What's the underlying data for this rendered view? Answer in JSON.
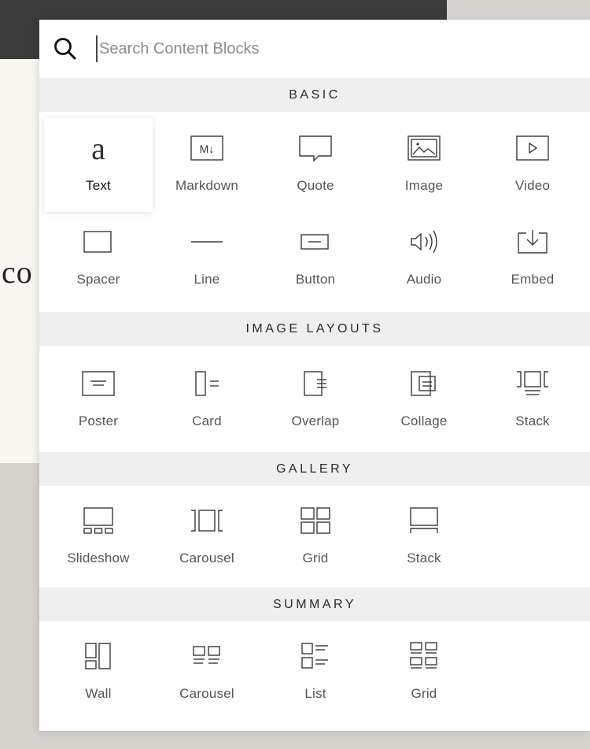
{
  "background": {
    "partial_text": "co"
  },
  "search": {
    "placeholder": "Search Content Blocks",
    "value": ""
  },
  "sections": {
    "basic": {
      "title": "BASIC",
      "items": [
        "Text",
        "Markdown",
        "Quote",
        "Image",
        "Video",
        "Spacer",
        "Line",
        "Button",
        "Audio",
        "Embed"
      ]
    },
    "image_layouts": {
      "title": "IMAGE LAYOUTS",
      "items": [
        "Poster",
        "Card",
        "Overlap",
        "Collage",
        "Stack"
      ]
    },
    "gallery": {
      "title": "GALLERY",
      "items": [
        "Slideshow",
        "Carousel",
        "Grid",
        "Stack"
      ]
    },
    "summary": {
      "title": "SUMMARY",
      "items": [
        "Wall",
        "Carousel",
        "List",
        "Grid"
      ]
    }
  },
  "icons": {
    "search": "search-icon",
    "text": "text-icon",
    "markdown": "markdown-icon",
    "quote": "quote-icon",
    "image": "image-icon",
    "video": "video-icon",
    "spacer": "spacer-icon",
    "line": "line-icon",
    "button": "button-icon",
    "audio": "audio-icon",
    "embed": "embed-icon"
  },
  "colors": {
    "accent_text": "#111111",
    "label": "#555555",
    "header_bg": "#efefef",
    "top_bar": "#3b3b3b"
  }
}
